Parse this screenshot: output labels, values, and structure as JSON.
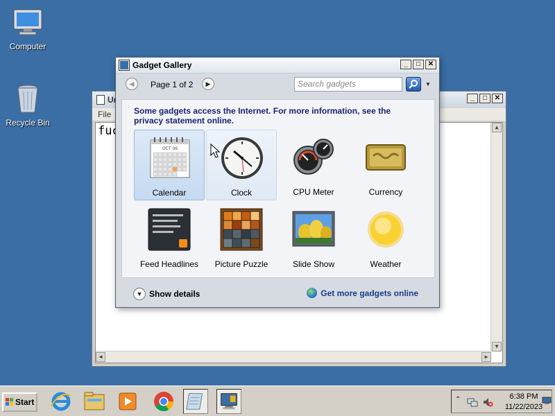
{
  "desktop": {
    "icons": [
      {
        "label": "Computer",
        "icon": "computer-icon"
      },
      {
        "label": "Recycle Bin",
        "icon": "recycle-bin-icon"
      }
    ]
  },
  "notepad": {
    "title": "Ur",
    "menu_file": "File",
    "text": "fuc"
  },
  "gallery": {
    "title": "Gadget Gallery",
    "page_info": "Page 1 of 2",
    "search_placeholder": "Search gadgets",
    "notice": "Some gadgets access the Internet.  For more information, see the privacy statement online.",
    "gadgets": [
      {
        "name": "Calendar",
        "icon": "calendar-icon"
      },
      {
        "name": "Clock",
        "icon": "clock-icon"
      },
      {
        "name": "CPU Meter",
        "icon": "cpu-meter-icon"
      },
      {
        "name": "Currency",
        "icon": "currency-icon"
      },
      {
        "name": "Feed Headlines",
        "icon": "feed-headlines-icon"
      },
      {
        "name": "Picture Puzzle",
        "icon": "picture-puzzle-icon"
      },
      {
        "name": "Slide Show",
        "icon": "slide-show-icon"
      },
      {
        "name": "Weather",
        "icon": "weather-icon"
      }
    ],
    "calendar_month": "OCT 06",
    "show_details": "Show details",
    "get_more": "Get more gadgets online",
    "window_buttons": {
      "minimize": "_",
      "maximize": "□",
      "close": "✕"
    }
  },
  "taskbar": {
    "start_label": "Start",
    "time": "6:38 PM",
    "date": "11/22/2023"
  },
  "colors": {
    "desktop": "#3a6ea5",
    "notice_text": "#1a2470",
    "link_text": "#1a3c8a",
    "selection": "#c5daf1"
  }
}
